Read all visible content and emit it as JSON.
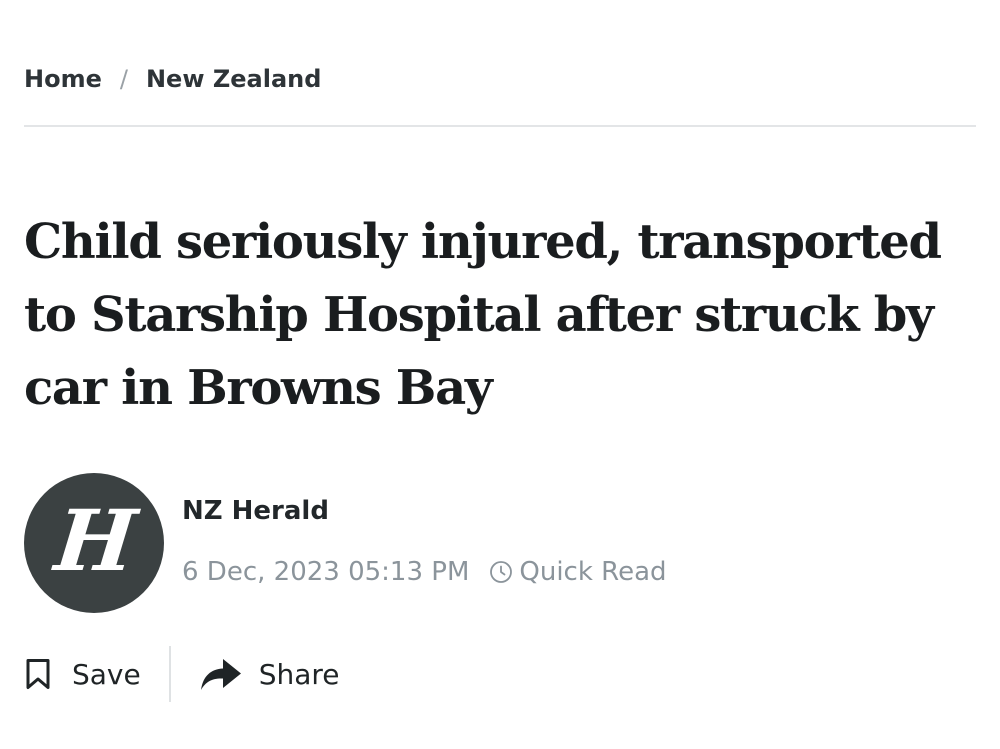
{
  "breadcrumb": {
    "home": "Home",
    "separator": "/",
    "section": "New Zealand"
  },
  "article": {
    "headline_lines": [
      "Child seriously injured, transported",
      "to Starship Hospital after struck by",
      "car in Browns Bay"
    ]
  },
  "byline": {
    "avatar_letter": "H",
    "author": "NZ Herald",
    "date": "6 Dec, 2023 05:13 PM",
    "read_time": "Quick Read",
    "read_icon": "clock-icon"
  },
  "actions": {
    "save_label": "Save",
    "save_icon": "bookmark-icon",
    "share_label": "Share",
    "share_icon": "share-arrow-icon"
  },
  "colors": {
    "text": "#1a1d1f",
    "muted": "#8b949b",
    "avatar_bg": "#3b4142",
    "divider": "#e3e5e7"
  }
}
